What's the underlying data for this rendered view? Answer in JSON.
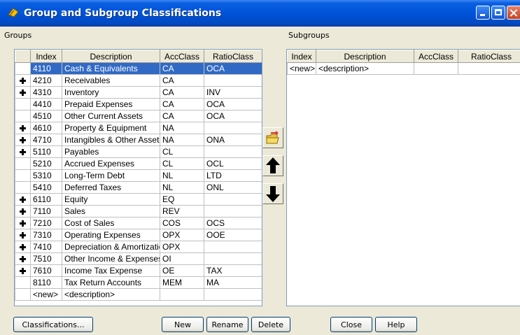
{
  "window": {
    "title": "Group and Subgroup Classifications"
  },
  "groups": {
    "label": "Groups",
    "columns": [
      "Index",
      "Description",
      "AccClass",
      "RatioClass"
    ],
    "rows": [
      {
        "index": "4110",
        "description": "Cash & Equivalents",
        "accclass": "CA",
        "ratioclass": "OCA",
        "expandable": false,
        "selected": true
      },
      {
        "index": "4210",
        "description": "Receivables",
        "accclass": "CA",
        "ratioclass": "",
        "expandable": true,
        "selected": false
      },
      {
        "index": "4310",
        "description": "Inventory",
        "accclass": "CA",
        "ratioclass": "INV",
        "expandable": true,
        "selected": false
      },
      {
        "index": "4410",
        "description": "Prepaid Expenses",
        "accclass": "CA",
        "ratioclass": "OCA",
        "expandable": false,
        "selected": false
      },
      {
        "index": "4510",
        "description": "Other Current Assets",
        "accclass": "CA",
        "ratioclass": "OCA",
        "expandable": false,
        "selected": false
      },
      {
        "index": "4610",
        "description": "Property & Equipment",
        "accclass": "NA",
        "ratioclass": "",
        "expandable": true,
        "selected": false
      },
      {
        "index": "4710",
        "description": "Intangibles & Other Assets",
        "accclass": "NA",
        "ratioclass": "ONA",
        "expandable": true,
        "selected": false
      },
      {
        "index": "5110",
        "description": "Payables",
        "accclass": "CL",
        "ratioclass": "",
        "expandable": true,
        "selected": false
      },
      {
        "index": "5210",
        "description": "Accrued Expenses",
        "accclass": "CL",
        "ratioclass": "OCL",
        "expandable": false,
        "selected": false
      },
      {
        "index": "5310",
        "description": "Long-Term Debt",
        "accclass": "NL",
        "ratioclass": "LTD",
        "expandable": false,
        "selected": false
      },
      {
        "index": "5410",
        "description": "Deferred Taxes",
        "accclass": "NL",
        "ratioclass": "ONL",
        "expandable": false,
        "selected": false
      },
      {
        "index": "6110",
        "description": "Equity",
        "accclass": "EQ",
        "ratioclass": "",
        "expandable": true,
        "selected": false
      },
      {
        "index": "7110",
        "description": "Sales",
        "accclass": "REV",
        "ratioclass": "",
        "expandable": true,
        "selected": false
      },
      {
        "index": "7210",
        "description": "Cost of Sales",
        "accclass": "COS",
        "ratioclass": "OCS",
        "expandable": true,
        "selected": false
      },
      {
        "index": "7310",
        "description": "Operating Expenses",
        "accclass": "OPX",
        "ratioclass": "OOE",
        "expandable": true,
        "selected": false
      },
      {
        "index": "7410",
        "description": "Depreciation & Amortization",
        "accclass": "OPX",
        "ratioclass": "",
        "expandable": true,
        "selected": false
      },
      {
        "index": "7510",
        "description": "Other Income & Expenses",
        "accclass": "OI",
        "ratioclass": "",
        "expandable": true,
        "selected": false
      },
      {
        "index": "7610",
        "description": "Income Tax Expense",
        "accclass": "OE",
        "ratioclass": "TAX",
        "expandable": true,
        "selected": false
      },
      {
        "index": "8110",
        "description": "Tax Return Accounts",
        "accclass": "MEM",
        "ratioclass": "MA",
        "expandable": false,
        "selected": false
      },
      {
        "index": "<new>",
        "description": "<description>",
        "accclass": "",
        "ratioclass": "",
        "expandable": false,
        "selected": false
      }
    ]
  },
  "subgroups": {
    "label": "Subgroups",
    "columns": [
      "Index",
      "Description",
      "AccClass",
      "RatioClass"
    ],
    "rows": [
      {
        "index": "<new>",
        "description": "<description>",
        "accclass": "",
        "ratioclass": ""
      }
    ]
  },
  "buttons": {
    "classifications": "Classifications...",
    "new": "New",
    "rename": "Rename",
    "delete": "Delete",
    "close": "Close",
    "help": "Help"
  },
  "side_icons": [
    "move-to-subgroup-icon",
    "move-up-arrow-icon",
    "move-down-arrow-icon"
  ],
  "colors": {
    "selection": "#316ac5",
    "titlebar": "#0053d9",
    "window_bg": "#ece9d8"
  }
}
